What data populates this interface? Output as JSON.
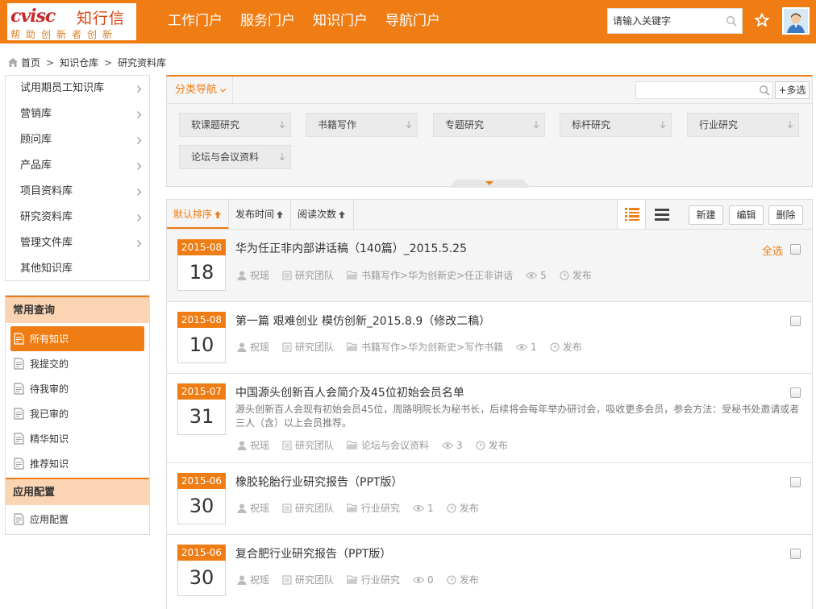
{
  "header": {
    "logo_mark": "cvisc",
    "logo_name": "知行信",
    "logo_slogan": "帮助创新者创新",
    "nav": [
      "工作门户",
      "服务门户",
      "知识门户",
      "导航门户"
    ],
    "search_placeholder": "请输入关键字"
  },
  "breadcrumb": [
    "首页",
    "知识仓库",
    "研究资料库"
  ],
  "sidebar": {
    "categories": [
      "试用期员工知识库",
      "营销库",
      "顾问库",
      "产品库",
      "项目资料库",
      "研究资料库",
      "管理文件库",
      "其他知识库"
    ],
    "common_query_title": "常用查询",
    "common_query": [
      "所有知识",
      "我提交的",
      "待我审的",
      "我已审的",
      "精华知识",
      "推荐知识"
    ],
    "app_config_title": "应用配置",
    "app_config": [
      "应用配置"
    ]
  },
  "filter": {
    "dropdown_label": "分类导航",
    "more_label": "+多选",
    "tags": [
      "软课题研究",
      "书籍写作",
      "专题研究",
      "标杆研究",
      "行业研究",
      "论坛与会议资料"
    ]
  },
  "sortbar": {
    "sorts": [
      "默认排序",
      "发布时间",
      "阅读次数"
    ],
    "actions": [
      "新建",
      "编辑",
      "删除"
    ]
  },
  "select_all_label": "全选",
  "records": [
    {
      "ym": "2015-08",
      "day": "18",
      "title": "华为任正非内部讲话稿（140篇）_2015.5.25",
      "desc": "",
      "author": "祝瑶",
      "team": "研究团队",
      "path": "书籍写作>华为创新史>任正非讲话",
      "reads": "5",
      "status": "发布"
    },
    {
      "ym": "2015-08",
      "day": "10",
      "title": "第一篇 艰难创业 模仿创新_2015.8.9（修改二稿）",
      "desc": "",
      "author": "祝瑶",
      "team": "研究团队",
      "path": "书籍写作>华为创新史>写作书籍",
      "reads": "1",
      "status": "发布"
    },
    {
      "ym": "2015-07",
      "day": "31",
      "title": "中国源头创新百人会简介及45位初始会员名单",
      "desc": "源头创新百人会现有初始会员45位，周路明院长为秘书长，后续将会每年举办研讨会，吸收更多会员，参会方法：受秘书处邀请或者三人（含）以上会员推荐。",
      "author": "祝瑶",
      "team": "研究团队",
      "path": "论坛与会议资料",
      "reads": "3",
      "status": "发布"
    },
    {
      "ym": "2015-06",
      "day": "30",
      "title": "橡胶轮胎行业研究报告（PPT版）",
      "desc": "",
      "author": "祝瑶",
      "team": "研究团队",
      "path": "行业研究",
      "reads": "1",
      "status": "发布"
    },
    {
      "ym": "2015-06",
      "day": "30",
      "title": "复合肥行业研究报告（PPT版）",
      "desc": "",
      "author": "祝瑶",
      "team": "研究团队",
      "path": "行业研究",
      "reads": "0",
      "status": "发布"
    }
  ],
  "colors": {
    "accent": "#f07d14",
    "accent_light": "#fbd4b4"
  },
  "icons": [
    "search-icon",
    "star-icon",
    "home-icon",
    "chevron-right-icon",
    "document-icon",
    "user-icon",
    "team-icon",
    "folder-icon",
    "eye-icon",
    "clock-icon",
    "list-view-icon",
    "compact-view-icon",
    "sort-up-icon",
    "arrow-down-icon"
  ]
}
